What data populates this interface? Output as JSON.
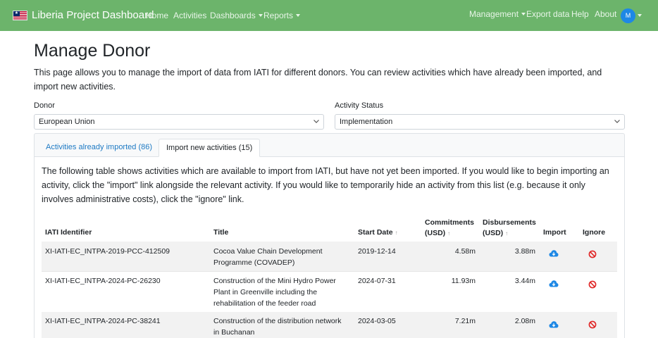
{
  "navbar": {
    "brand": "Liberia Project Dashboard",
    "left_links": [
      "Home",
      "Activities",
      "Dashboards",
      "Reports"
    ],
    "right_links": [
      "Management",
      "Export data",
      "Help",
      "About"
    ],
    "avatar_initial": "M",
    "color": "#6cb46b"
  },
  "page": {
    "title": "Manage Donor",
    "intro": "This page allows you to manage the import of data from IATI for different donors. You can review activities which have already been imported, and import new activities."
  },
  "filters": {
    "donor_label": "Donor",
    "donor_value": "European Union",
    "status_label": "Activity Status",
    "status_value": "Implementation"
  },
  "tabs": {
    "imported": "Activities already imported (86)",
    "new": "Import new activities (15)"
  },
  "table_description": "The following table shows activities which are available to import from IATI, but have not yet been imported. If you would like to begin importing an activity, click the \"import\" link alongside the relevant activity. If you would like to temporarily hide an activity from this list (e.g. because it only involves administrative costs), click the \"ignore\" link.",
  "table": {
    "headers": {
      "identifier": "IATI Identifier",
      "title": "Title",
      "start_date": "Start Date",
      "commitments_1": "Commitments",
      "commitments_2": "(USD)",
      "disbursements_1": "Disbursements",
      "disbursements_2": "(USD)",
      "import": "Import",
      "ignore": "Ignore"
    },
    "rows": [
      {
        "identifier": "XI-IATI-EC_INTPA-2019-PCC-412509",
        "title_lines": [
          "Cocoa Value Chain Development",
          "Programme (COVADEP)",
          ""
        ],
        "start_date": "2019-12-14",
        "commitments": "4.58m",
        "disbursements": "3.88m"
      },
      {
        "identifier": "XI-IATI-EC_INTPA-2024-PC-26230",
        "title_lines": [
          "Construction of the Mini Hydro Power",
          "Plant in Greenville including the",
          "rehabilitation of the feeder road"
        ],
        "start_date": "2024-07-31",
        "commitments": "11.93m",
        "disbursements": "3.44m"
      },
      {
        "identifier": "XI-IATI-EC_INTPA-2024-PC-38241",
        "title_lines": [
          "Construction of the distribution network",
          "in Buchanan",
          ""
        ],
        "start_date": "2024-03-05",
        "commitments": "7.21m",
        "disbursements": "2.08m"
      }
    ]
  },
  "colors": {
    "import_icon": "#1e88e5",
    "ignore_icon": "#e02424",
    "link": "#1e7ac4"
  }
}
